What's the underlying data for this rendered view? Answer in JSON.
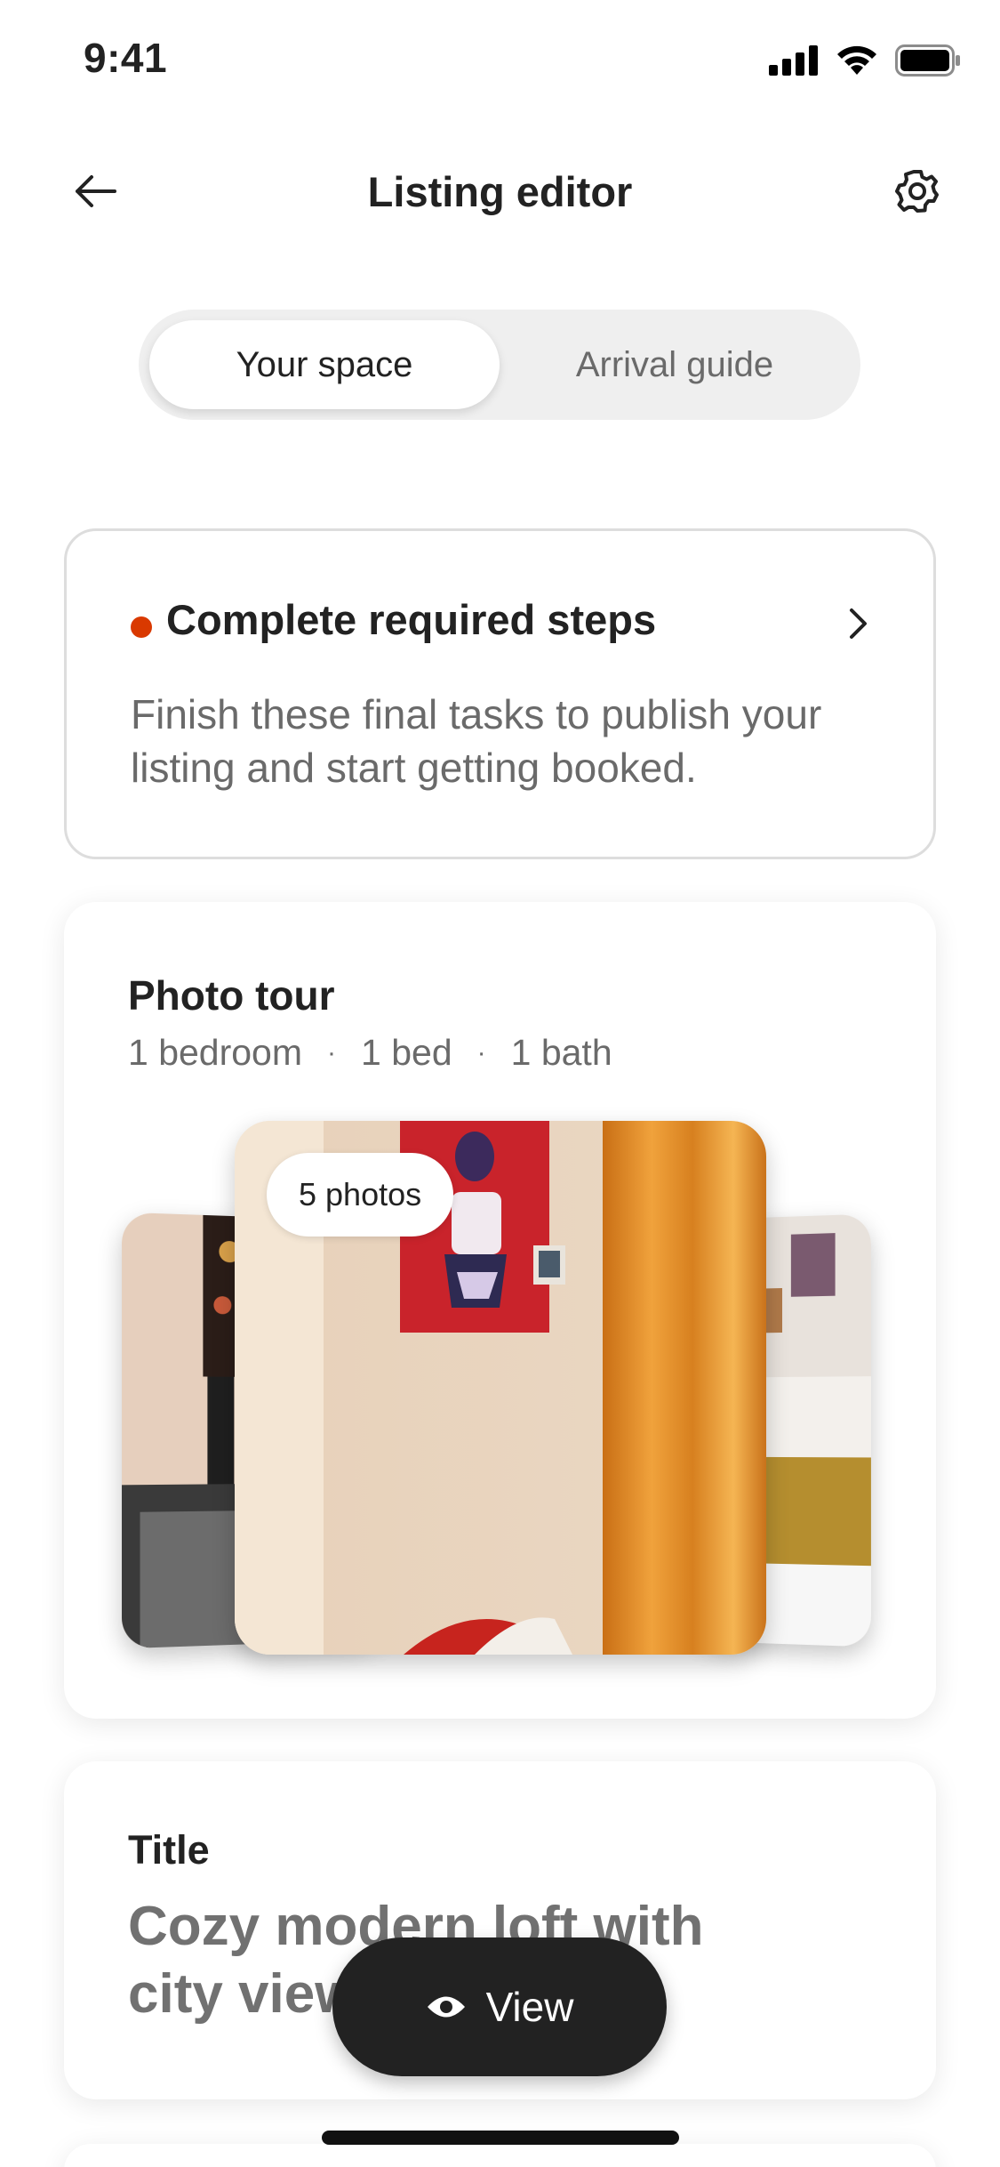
{
  "status_bar": {
    "time": "9:41"
  },
  "header": {
    "title": "Listing editor"
  },
  "tabs": [
    {
      "label": "Your space",
      "active": true
    },
    {
      "label": "Arrival guide",
      "active": false
    }
  ],
  "steps_card": {
    "title": "Complete required steps",
    "description": "Finish these final tasks to publish your listing and start getting booked.",
    "dot_color": "#d93900"
  },
  "photo_tour": {
    "title": "Photo tour",
    "meta": [
      "1 bedroom",
      "1 bed",
      "1 bath"
    ],
    "meta_separator": "·",
    "badge": "5 photos"
  },
  "title_card": {
    "label": "Title",
    "value": "Cozy modern loft with city view"
  },
  "view_button": {
    "label": "View"
  },
  "colors": {
    "accent": "#d93900",
    "dark_button": "#222222",
    "muted_text": "#6a6a6a"
  }
}
